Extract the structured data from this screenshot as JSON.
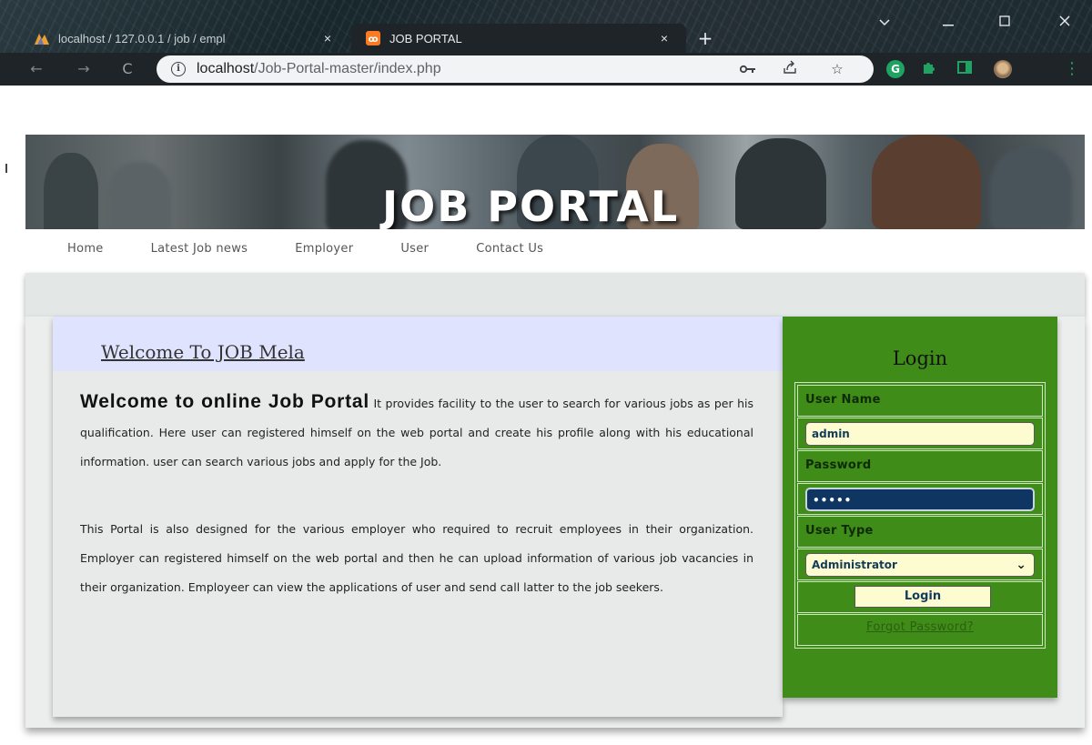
{
  "browser": {
    "tabs": [
      {
        "title": "localhost / 127.0.0.1 / job / empl",
        "active": false
      },
      {
        "title": "JOB PORTAL",
        "active": true
      }
    ],
    "url_host": "localhost",
    "url_path": "/Job-Portal-master/index.php",
    "new_tab": "+",
    "close_glyph": "×"
  },
  "site": {
    "banner_title": "JOB PORTAL",
    "nav": [
      "Home",
      "Latest Job news",
      "Employer",
      "User",
      "Contact Us"
    ]
  },
  "content": {
    "welcome_title": "Welcome To JOB Mela",
    "intro_lead": "Welcome to online Job Portal",
    "intro_text": " It provides facility to the user to search for various jobs as per his qualification. Here user can registered himself on the web portal and create his profile along with his educational information. user can search various jobs and apply for the Job.",
    "paragraph2": "This Portal is also designed for the various employer who required to recruit employees in their organization. Employer can registered himself on the web portal and then he can upload information of various job vacancies in their organization. Employeer can view the applications of user and send call latter to the job seekers."
  },
  "login": {
    "title": "Login",
    "username_label": "User Name",
    "username_value": "admin",
    "password_label": "Password",
    "password_value": "•••••",
    "usertype_label": "User Type",
    "usertype_value": "Administrator",
    "button": "Login",
    "forgot": "Forgot Password?"
  },
  "colors": {
    "login_panel": "#3f8d18",
    "welcome_header_bg": "#dfe3fd",
    "browser_toolbar": "#1e2428"
  }
}
